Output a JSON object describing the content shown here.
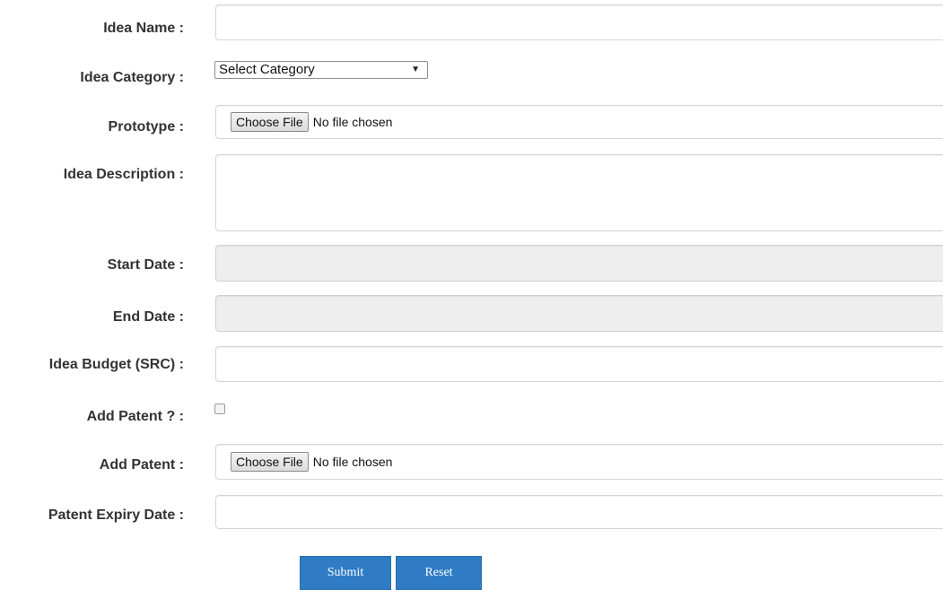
{
  "form": {
    "idea_name": {
      "label": "Idea Name :",
      "value": ""
    },
    "idea_category": {
      "label": "Idea Category :",
      "selected": "Select Category"
    },
    "prototype": {
      "label": "Prototype :",
      "button": "Choose File",
      "status": "No file chosen"
    },
    "idea_description": {
      "label": "Idea Description :",
      "value": ""
    },
    "start_date": {
      "label": "Start Date :",
      "value": ""
    },
    "end_date": {
      "label": "End Date :",
      "value": ""
    },
    "idea_budget": {
      "label": "Idea Budget (SRC) :",
      "value": ""
    },
    "add_patent_check": {
      "label": "Add Patent ? :",
      "checked": false
    },
    "add_patent_file": {
      "label": "Add Patent :",
      "button": "Choose File",
      "status": "No file chosen"
    },
    "patent_expiry": {
      "label": "Patent Expiry Date :",
      "value": ""
    }
  },
  "actions": {
    "submit": "Submit",
    "reset": "Reset"
  }
}
